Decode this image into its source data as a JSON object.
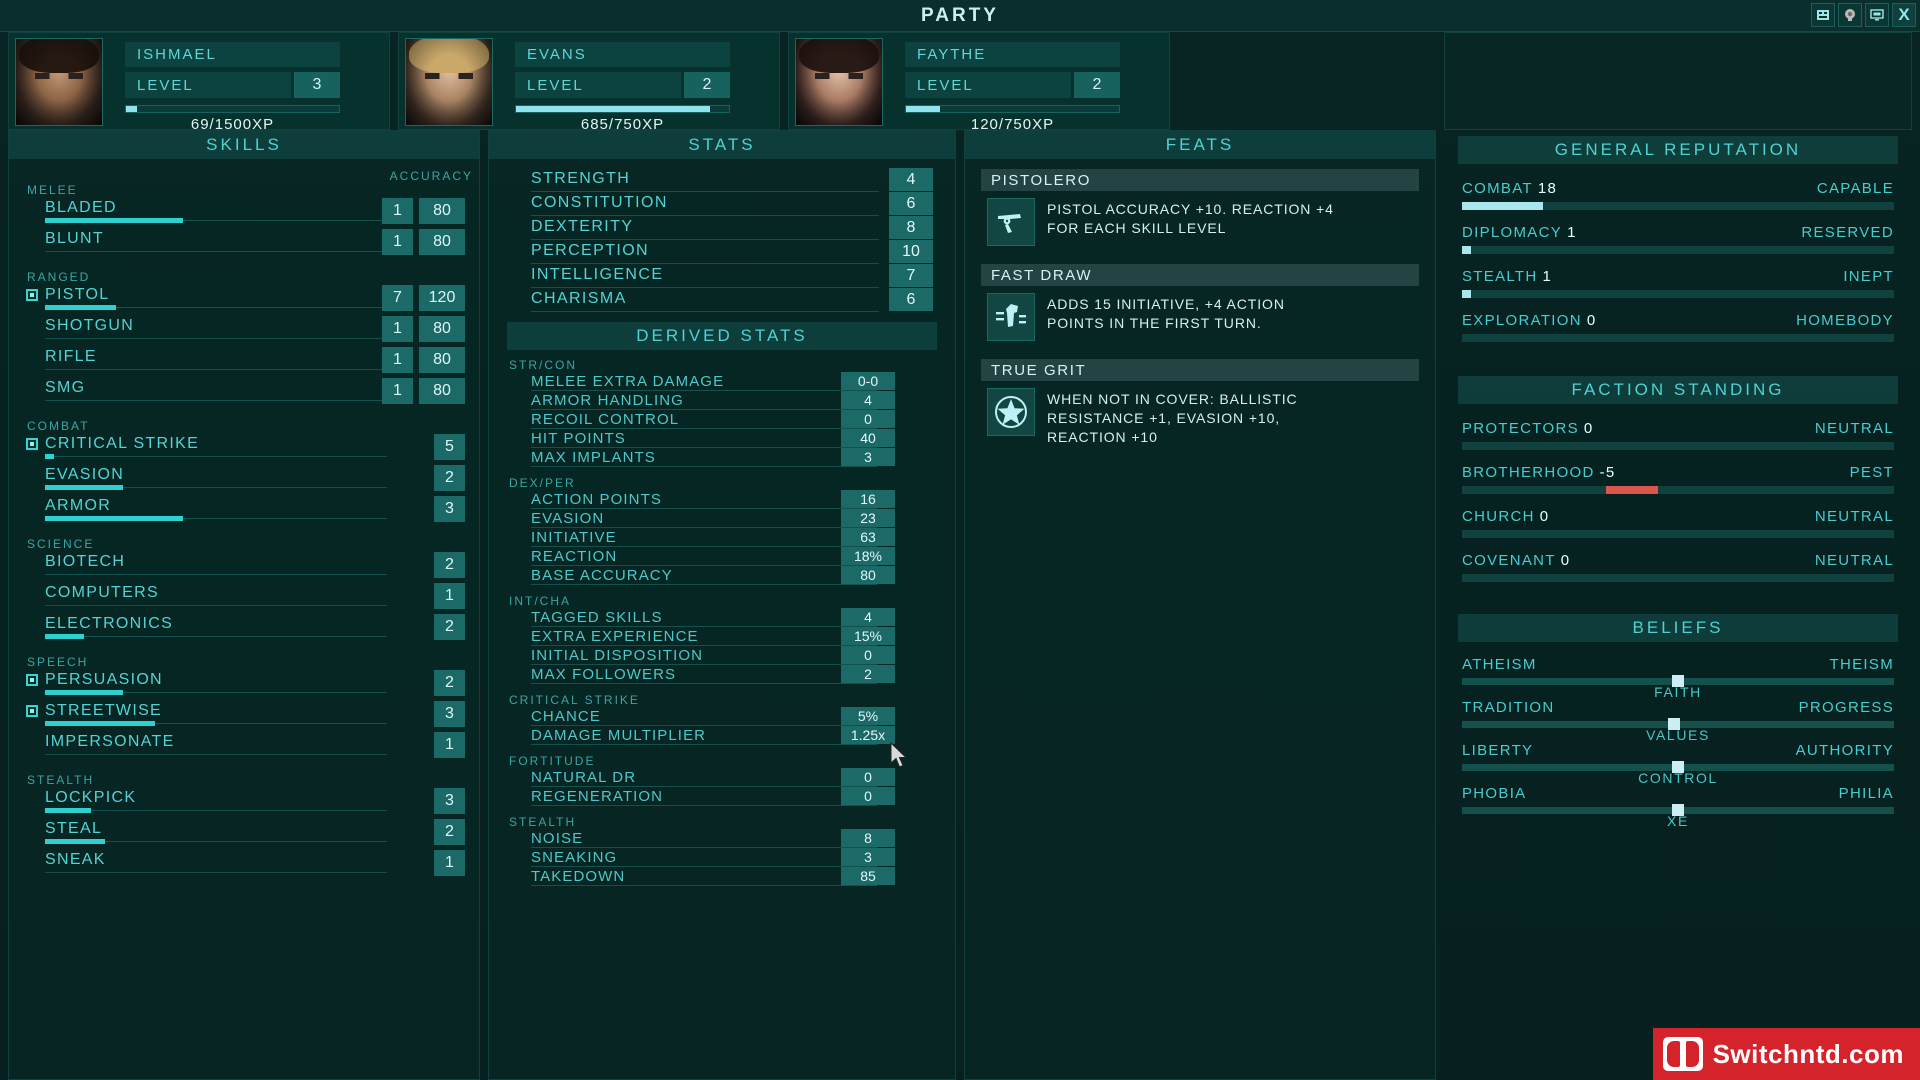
{
  "window": {
    "title": "PARTY",
    "buttons": [
      {
        "name": "inventory-icon",
        "glyph": "inventory"
      },
      {
        "name": "character-icon",
        "glyph": "head"
      },
      {
        "name": "log-icon",
        "glyph": "monitor"
      },
      {
        "name": "close-button",
        "glyph": "X"
      }
    ]
  },
  "party": [
    {
      "name": "ISHMAEL",
      "level_label": "LEVEL",
      "level": "3",
      "xp": "69/1500XP",
      "xp_pct": 5
    },
    {
      "name": "EVANS",
      "level_label": "LEVEL",
      "level": "2",
      "xp": "685/750XP",
      "xp_pct": 91
    },
    {
      "name": "FAYTHE",
      "level_label": "LEVEL",
      "level": "2",
      "xp": "120/750XP",
      "xp_pct": 16
    }
  ],
  "skills": {
    "header": "SKILLS",
    "accuracy_header": "ACCURACY",
    "groups": [
      {
        "label": "MELEE",
        "items": [
          {
            "name": "BLADED",
            "level": "1",
            "accuracy": "80",
            "bar_pct": 60,
            "tagged": false
          },
          {
            "name": "BLUNT",
            "level": "1",
            "accuracy": "80",
            "bar_pct": 0,
            "tagged": false
          }
        ]
      },
      {
        "label": "RANGED",
        "items": [
          {
            "name": "PISTOL",
            "level": "7",
            "accuracy": "120",
            "bar_pct": 31,
            "tagged": true
          },
          {
            "name": "SHOTGUN",
            "level": "1",
            "accuracy": "80",
            "bar_pct": 0,
            "tagged": false
          },
          {
            "name": "RIFLE",
            "level": "1",
            "accuracy": "80",
            "bar_pct": 0,
            "tagged": false
          },
          {
            "name": "SMG",
            "level": "1",
            "accuracy": "80",
            "bar_pct": 0,
            "tagged": false
          }
        ]
      },
      {
        "label": "COMBAT",
        "items": [
          {
            "name": "CRITICAL STRIKE",
            "level": "5",
            "bar_pct": 4,
            "tagged": true
          },
          {
            "name": "EVASION",
            "level": "2",
            "bar_pct": 34,
            "tagged": false
          },
          {
            "name": "ARMOR",
            "level": "3",
            "bar_pct": 60,
            "tagged": false
          }
        ]
      },
      {
        "label": "SCIENCE",
        "items": [
          {
            "name": "BIOTECH",
            "level": "2",
            "bar_pct": 0,
            "tagged": false
          },
          {
            "name": "COMPUTERS",
            "level": "1",
            "bar_pct": 0,
            "tagged": false
          },
          {
            "name": "ELECTRONICS",
            "level": "2",
            "bar_pct": 17,
            "tagged": false
          }
        ]
      },
      {
        "label": "SPEECH",
        "items": [
          {
            "name": "PERSUASION",
            "level": "2",
            "bar_pct": 34,
            "tagged": true
          },
          {
            "name": "STREETWISE",
            "level": "3",
            "bar_pct": 48,
            "tagged": true
          },
          {
            "name": "IMPERSONATE",
            "level": "1",
            "bar_pct": 0,
            "tagged": false
          }
        ]
      },
      {
        "label": "STEALTH",
        "items": [
          {
            "name": "LOCKPICK",
            "level": "3",
            "bar_pct": 20,
            "tagged": false
          },
          {
            "name": "STEAL",
            "level": "2",
            "bar_pct": 26,
            "tagged": false
          },
          {
            "name": "SNEAK",
            "level": "1",
            "bar_pct": 0,
            "tagged": false
          }
        ]
      }
    ]
  },
  "stats": {
    "header": "STATS",
    "primary": [
      {
        "name": "STRENGTH",
        "value": "4"
      },
      {
        "name": "CONSTITUTION",
        "value": "6"
      },
      {
        "name": "DEXTERITY",
        "value": "8"
      },
      {
        "name": "PERCEPTION",
        "value": "10"
      },
      {
        "name": "INTELLIGENCE",
        "value": "7"
      },
      {
        "name": "CHARISMA",
        "value": "6"
      }
    ],
    "derived_header": "DERIVED STATS",
    "derived": [
      {
        "group": "STR/CON",
        "items": [
          {
            "name": "MELEE EXTRA DAMAGE",
            "value": "0-0"
          },
          {
            "name": "ARMOR HANDLING",
            "value": "4"
          },
          {
            "name": "RECOIL CONTROL",
            "value": "0"
          },
          {
            "name": "HIT POINTS",
            "value": "40"
          },
          {
            "name": "MAX IMPLANTS",
            "value": "3"
          }
        ]
      },
      {
        "group": "DEX/PER",
        "items": [
          {
            "name": "ACTION POINTS",
            "value": "16"
          },
          {
            "name": "EVASION",
            "value": "23"
          },
          {
            "name": "INITIATIVE",
            "value": "63"
          },
          {
            "name": "REACTION",
            "value": "18%"
          },
          {
            "name": "BASE ACCURACY",
            "value": "80"
          }
        ]
      },
      {
        "group": "INT/CHA",
        "items": [
          {
            "name": "TAGGED SKILLS",
            "value": "4"
          },
          {
            "name": "EXTRA EXPERIENCE",
            "value": "15%"
          },
          {
            "name": "INITIAL DISPOSITION",
            "value": "0"
          },
          {
            "name": "MAX FOLLOWERS",
            "value": "2"
          }
        ]
      },
      {
        "group": "CRITICAL STRIKE",
        "items": [
          {
            "name": "CHANCE",
            "value": "5%"
          },
          {
            "name": "DAMAGE MULTIPLIER",
            "value": "1.25x"
          }
        ]
      },
      {
        "group": "FORTITUDE",
        "items": [
          {
            "name": "NATURAL DR",
            "value": "0"
          },
          {
            "name": "REGENERATION",
            "value": "0"
          }
        ]
      },
      {
        "group": "STEALTH",
        "items": [
          {
            "name": "NOISE",
            "value": "8"
          },
          {
            "name": "SNEAKING",
            "value": "3"
          },
          {
            "name": "TAKEDOWN",
            "value": "85"
          }
        ]
      }
    ]
  },
  "feats": {
    "header": "FEATS",
    "items": [
      {
        "title": "PISTOLERO",
        "icon": "revolver-icon",
        "text": "PISTOL ACCURACY +10. REACTION +4 FOR EACH SKILL LEVEL"
      },
      {
        "title": "FAST DRAW",
        "icon": "fast-draw-icon",
        "text": "ADDS 15 INITIATIVE, +4 ACTION POINTS IN THE FIRST TURN."
      },
      {
        "title": "TRUE GRIT",
        "icon": "star-icon",
        "text": "WHEN NOT IN COVER: BALLISTIC RESISTANCE +1, EVASION +10, REACTION +10"
      }
    ]
  },
  "reputation": {
    "header": "GENERAL REPUTATION",
    "items": [
      {
        "name": "COMBAT",
        "value": "18",
        "rank": "CAPABLE",
        "pct": 18,
        "kind": "pos"
      },
      {
        "name": "DIPLOMACY",
        "value": "1",
        "rank": "RESERVED",
        "pct": 2,
        "kind": "pos"
      },
      {
        "name": "STEALTH",
        "value": "1",
        "rank": "INEPT",
        "pct": 2,
        "kind": "pos"
      },
      {
        "name": "EXPLORATION",
        "value": "0",
        "rank": "HOMEBODY",
        "pct": 0,
        "kind": "pos"
      }
    ]
  },
  "faction": {
    "header": "FACTION STANDING",
    "items": [
      {
        "name": "PROTECTORS",
        "value": "0",
        "rank": "NEUTRAL",
        "pct": 0,
        "kind": "neutral"
      },
      {
        "name": "BROTHERHOOD",
        "value": "-5",
        "rank": "PEST",
        "pct": 13,
        "kind": "neg"
      },
      {
        "name": "CHURCH",
        "value": "0",
        "rank": "NEUTRAL",
        "pct": 0,
        "kind": "neutral"
      },
      {
        "name": "COVENANT",
        "value": "0",
        "rank": "NEUTRAL",
        "pct": 0,
        "kind": "neutral"
      }
    ]
  },
  "beliefs": {
    "header": "BELIEFS",
    "items": [
      {
        "left": "ATHEISM",
        "right": "THEISM",
        "caption": "FAITH",
        "knob_pct": 50
      },
      {
        "left": "TRADITION",
        "right": "PROGRESS",
        "caption": "VALUES",
        "knob_pct": 49
      },
      {
        "left": "LIBERTY",
        "right": "AUTHORITY",
        "caption": "CONTROL",
        "knob_pct": 50
      },
      {
        "left": "PHOBIA",
        "right": "PHILIA",
        "caption": "XE",
        "knob_pct": 50
      }
    ]
  },
  "watermark": {
    "text": "Switchntd.com"
  }
}
